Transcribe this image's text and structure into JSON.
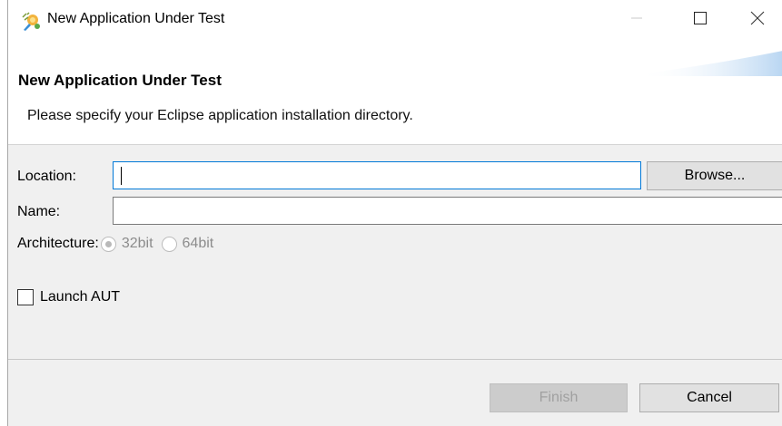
{
  "window": {
    "title": "New Application Under Test",
    "icon": "aut-wizard-icon",
    "controls": {
      "minimize": "minimize-icon",
      "maximize": "maximize-icon",
      "close": "close-icon"
    }
  },
  "header": {
    "title": "New Application Under Test",
    "description": "Please specify your Eclipse application installation directory."
  },
  "form": {
    "location_label": "Location:",
    "location_value": "",
    "browse_label": "Browse...",
    "name_label": "Name:",
    "name_value": "",
    "architecture_label": "Architecture:",
    "architecture_options": [
      "32bit",
      "64bit"
    ],
    "architecture_selected": "32bit",
    "launch_label": "Launch AUT",
    "launch_checked": false
  },
  "footer": {
    "finish_label": "Finish",
    "cancel_label": "Cancel"
  },
  "colors": {
    "focus_border": "#0078d7",
    "dialog_bg": "#f0f0f0",
    "disabled_text": "#a0a0a0"
  }
}
